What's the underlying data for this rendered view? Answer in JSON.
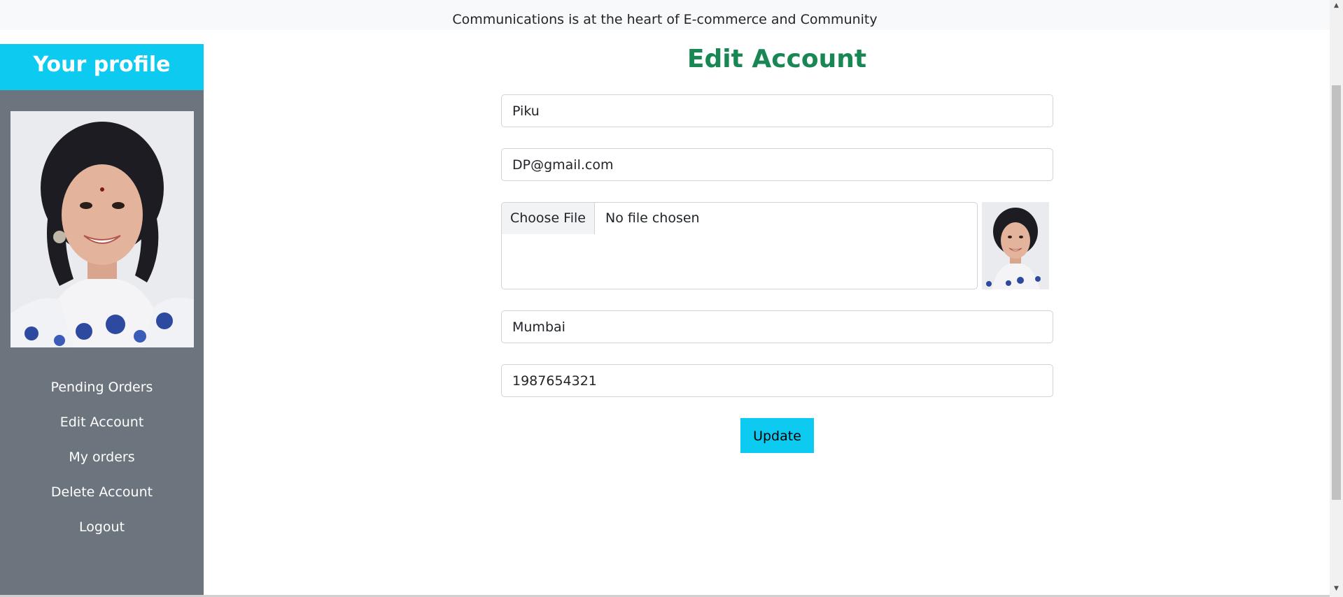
{
  "banner": {
    "text": "Communications is at the heart of E-commerce and Community"
  },
  "sidebar": {
    "title": "Your profile",
    "items": [
      {
        "label": "Pending Orders"
      },
      {
        "label": "Edit Account"
      },
      {
        "label": "My orders"
      },
      {
        "label": "Delete Account"
      },
      {
        "label": "Logout"
      }
    ]
  },
  "form": {
    "title": "Edit Account",
    "name_value": "Piku",
    "email_value": "DP@gmail.com",
    "file_button_label": "Choose File",
    "file_status": "No file chosen",
    "city_value": "Mumbai",
    "phone_value": "1987654321",
    "submit_label": "Update"
  },
  "colors": {
    "accent": "#0dcaf0",
    "title": "#198754",
    "sidebar": "#6c757d"
  }
}
